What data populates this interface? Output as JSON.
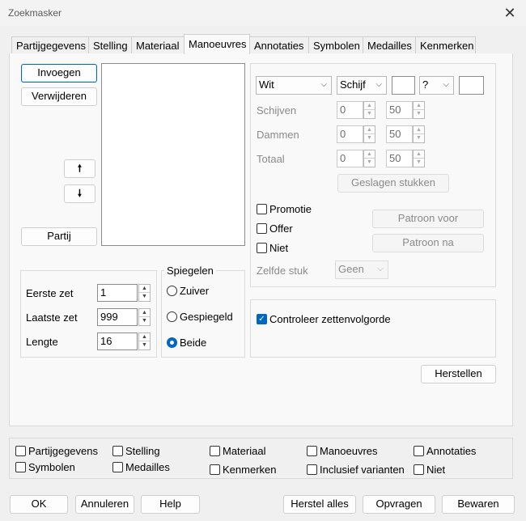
{
  "window": {
    "title": "Zoekmasker"
  },
  "tabs": [
    "Partijgegevens",
    "Stelling",
    "Materiaal",
    "Manoeuvres",
    "Annotaties",
    "Symbolen",
    "Medailles",
    "Kenmerken"
  ],
  "left": {
    "insert_label": "Invoegen",
    "remove_label": "Verwijderen",
    "up_arrow": "🠕",
    "down_arrow": "🠗",
    "partij_label": "Partij"
  },
  "moves": {
    "first_label": "Eerste zet",
    "first_value": "1",
    "last_label": "Laatste zet",
    "last_value": "999",
    "length_label": "Lengte",
    "length_value": "16"
  },
  "mirror": {
    "title": "Spiegelen",
    "options": [
      "Zuiver",
      "Gespiegeld",
      "Beide"
    ],
    "selected": "Beide"
  },
  "right": {
    "color_select": "Wit",
    "piece_select": "Schijf",
    "q_select": "?",
    "schijven_label": "Schijven",
    "schijven_min": "0",
    "schijven_max": "50",
    "dammen_label": "Dammen",
    "dammen_min": "0",
    "dammen_max": "50",
    "totaal_label": "Totaal",
    "totaal_min": "0",
    "totaal_max": "50",
    "captured_button": "Geslagen stukken",
    "promotie_label": "Promotie",
    "offer_label": "Offer",
    "niet_label": "Niet",
    "pattern_before": "Patroon voor",
    "pattern_after": "Patroon na",
    "same_piece_label": "Zelfde stuk",
    "same_piece_value": "Geen",
    "check_order_label": "Controleer zettenvolgorde",
    "reset_label": "Herstellen"
  },
  "filters": [
    {
      "label": "Partijgegevens",
      "checked": false
    },
    {
      "label": "Stelling",
      "checked": false
    },
    {
      "label": "Materiaal",
      "checked": false
    },
    {
      "label": "Manoeuvres",
      "checked": false
    },
    {
      "label": "Annotaties",
      "checked": false
    },
    {
      "label": "Symbolen",
      "checked": false
    },
    {
      "label": "Medailles",
      "checked": false
    },
    {
      "label": "Kenmerken",
      "checked": false
    },
    {
      "label": "Inclusief varianten",
      "checked": false
    },
    {
      "label": "Niet",
      "checked": false
    }
  ],
  "footer": {
    "ok": "OK",
    "cancel": "Annuleren",
    "help": "Help",
    "reset_all": "Herstel alles",
    "query": "Opvragen",
    "save": "Bewaren"
  },
  "colors": {
    "accent": "#0067c0"
  }
}
